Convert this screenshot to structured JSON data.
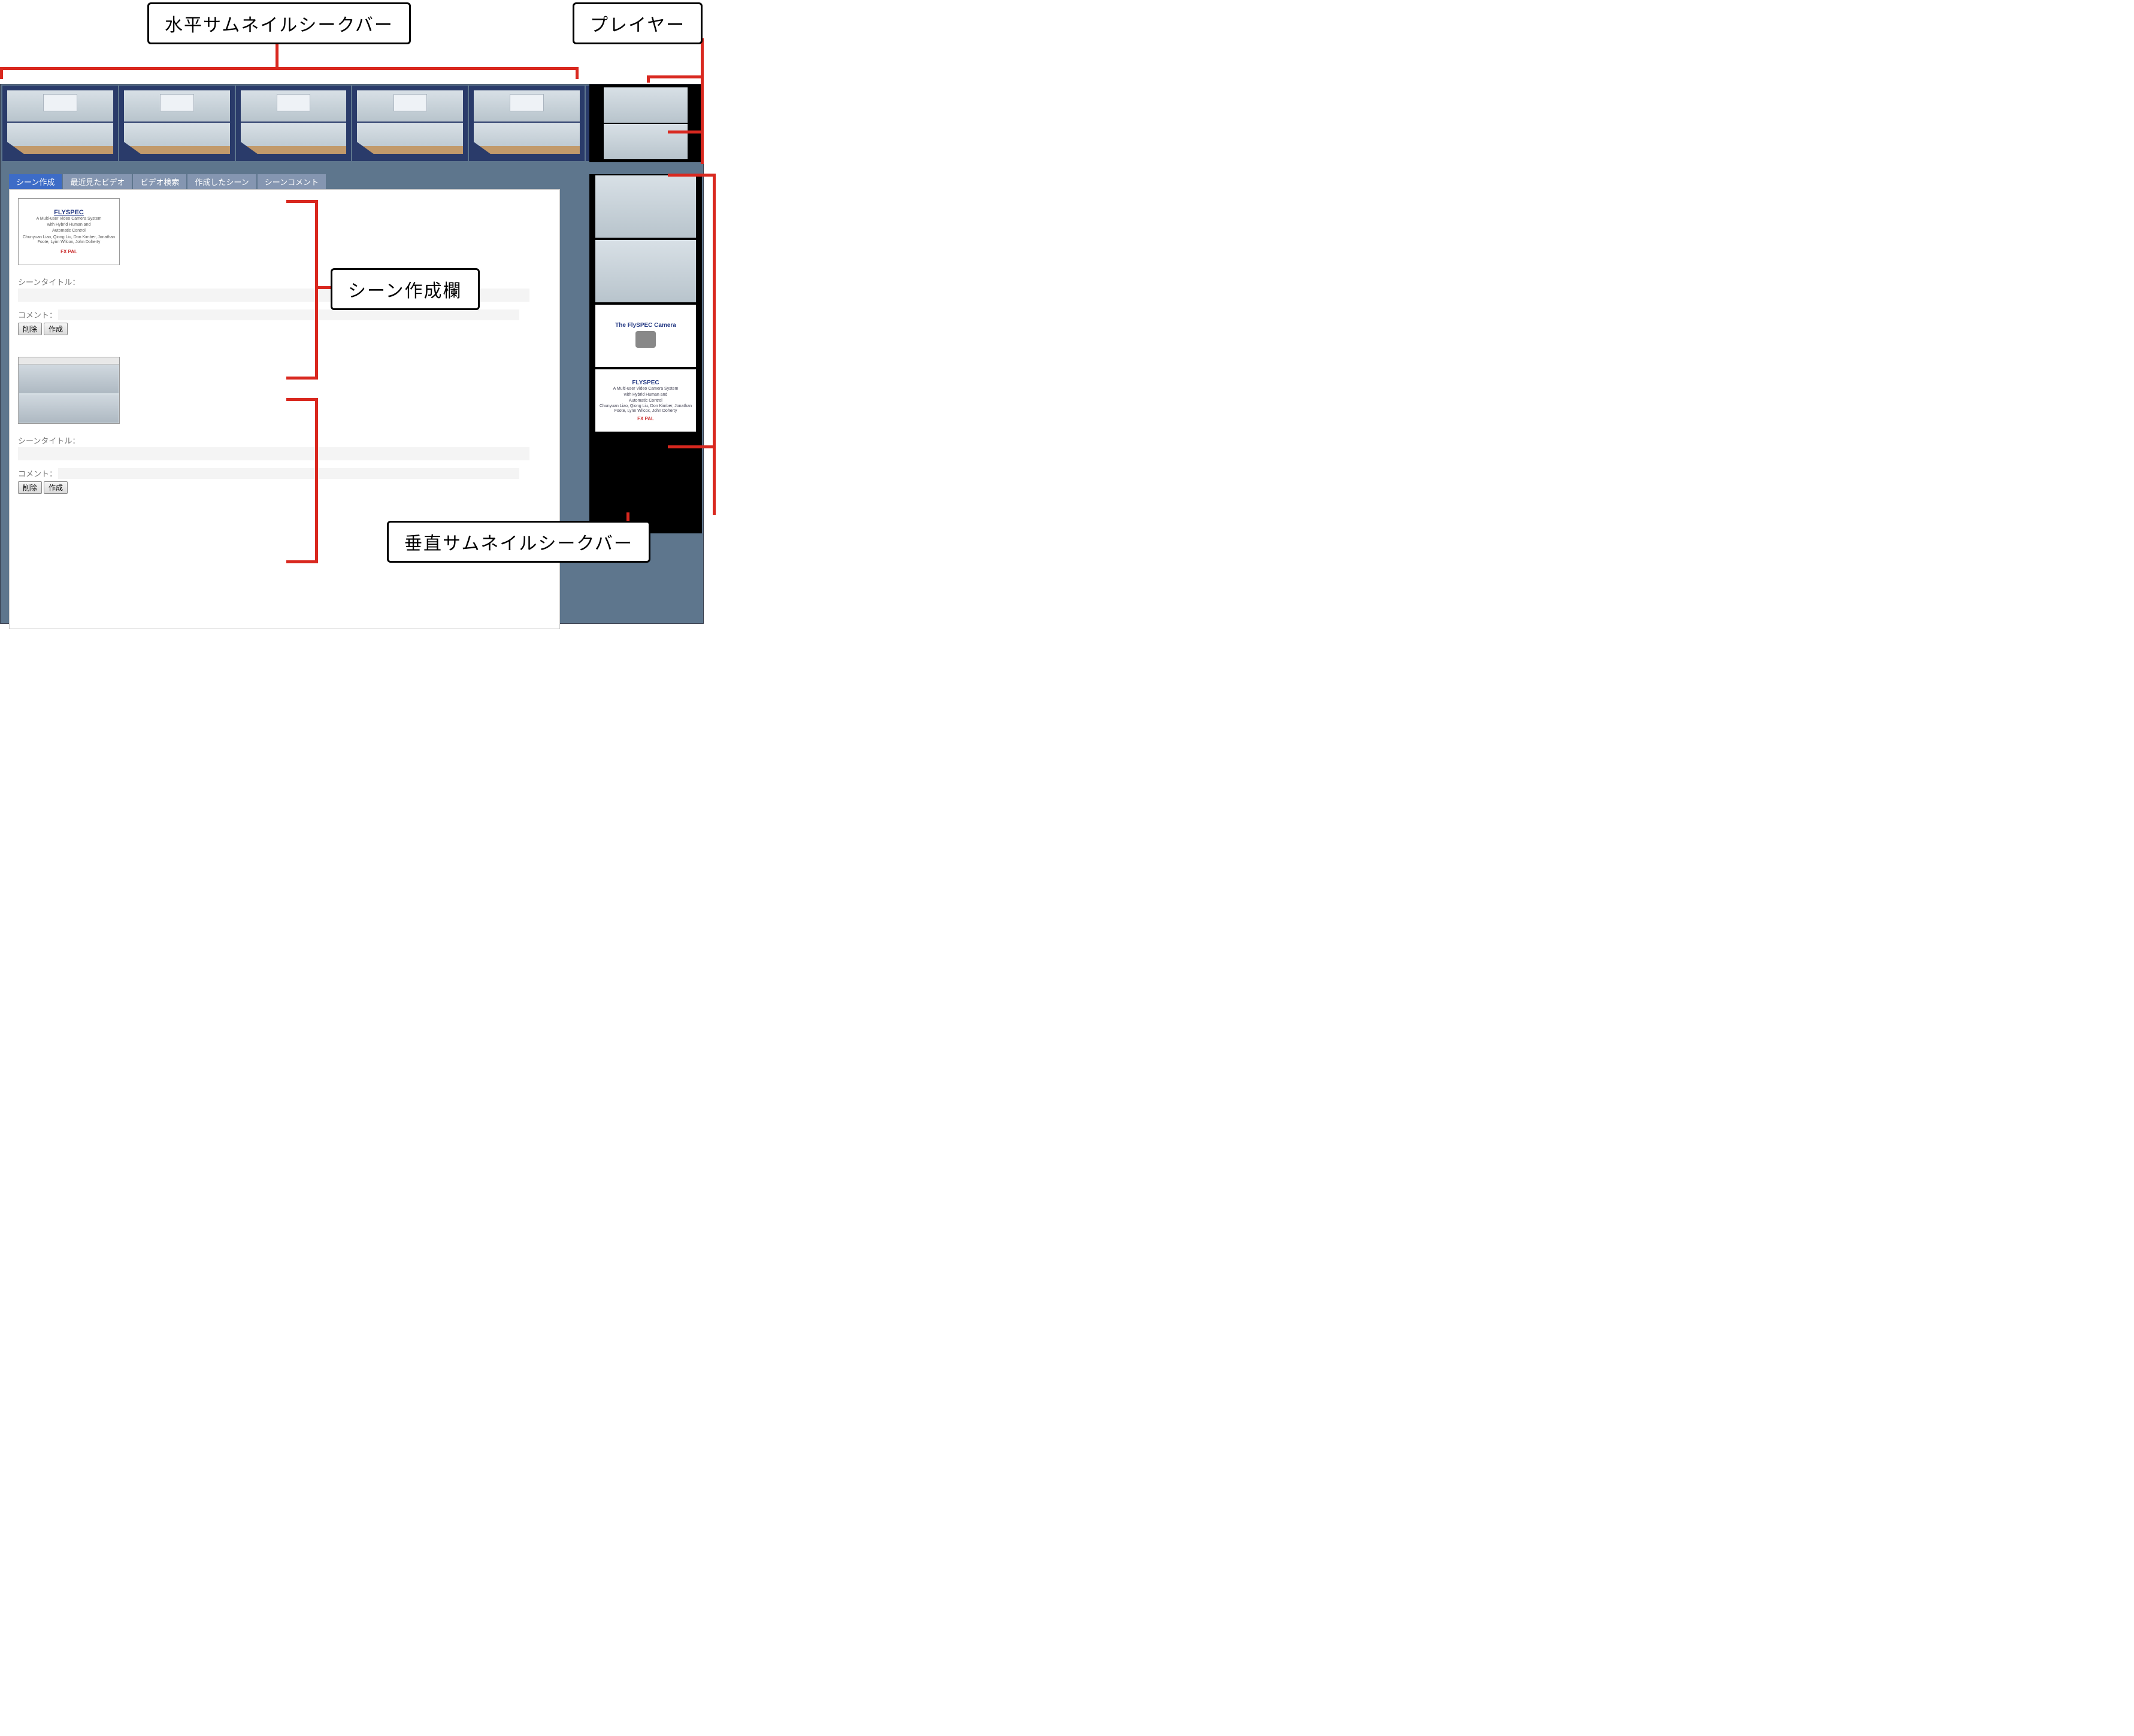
{
  "annotations": {
    "horizontal_seekbar": "水平サムネイルシークバー",
    "player": "プレイヤー",
    "scene_creation_field": "シーン作成欄",
    "vertical_seekbar": "垂直サムネイルシークバー"
  },
  "tabs": [
    {
      "id": "create",
      "label": "シーン作成",
      "active": true
    },
    {
      "id": "recent",
      "label": "最近見たビデオ",
      "active": false
    },
    {
      "id": "search",
      "label": "ビデオ検索",
      "active": false
    },
    {
      "id": "created",
      "label": "作成したシーン",
      "active": false
    },
    {
      "id": "comment",
      "label": "シーンコメント",
      "active": false
    }
  ],
  "form": {
    "scene_title_label": "シーンタイトル：",
    "comment_label": "コメント：",
    "delete_button": "削除",
    "create_button": "作成"
  },
  "slides": {
    "flyspec": {
      "title": "FLYSPEC",
      "subtitle1": "A Multi-user Video Camera System",
      "subtitle2": "with Hybrid Human and",
      "subtitle3": "Automatic Control",
      "authors": "Chunyuan Liao, Qiong Liu, Don Kimber, Jonathan Foote, Lynn Wilcox, John Doherty",
      "logo": "FX PAL"
    },
    "camera": {
      "title": "The FlySPEC Camera"
    }
  },
  "horizontal_thumbs_count": 6,
  "vertical_thumbs": [
    "room",
    "room",
    "camera_slide",
    "flyspec_slide"
  ],
  "scene_blocks": [
    "flyspec_slide",
    "room"
  ]
}
